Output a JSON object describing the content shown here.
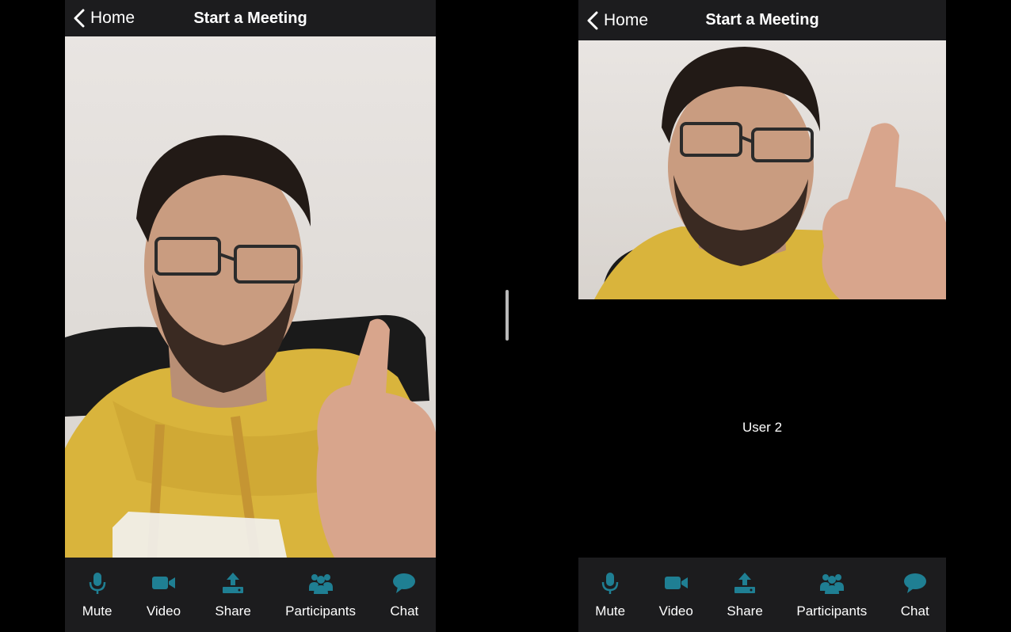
{
  "left_screen": {
    "nav": {
      "back_label": "Home",
      "title": "Start a Meeting"
    },
    "toolbar": [
      {
        "label": "Mute",
        "icon": "microphone-icon"
      },
      {
        "label": "Video",
        "icon": "video-camera-icon"
      },
      {
        "label": "Share",
        "icon": "share-upload-icon"
      },
      {
        "label": "Participants",
        "icon": "participants-icon"
      },
      {
        "label": "Chat",
        "icon": "chat-bubble-icon"
      }
    ]
  },
  "right_screen": {
    "nav": {
      "back_label": "Home",
      "title": "Start a Meeting"
    },
    "remote_user_label": "User 2",
    "toolbar": [
      {
        "label": "Mute",
        "icon": "microphone-icon"
      },
      {
        "label": "Video",
        "icon": "video-camera-icon"
      },
      {
        "label": "Share",
        "icon": "share-upload-icon"
      },
      {
        "label": "Participants",
        "icon": "participants-icon"
      },
      {
        "label": "Chat",
        "icon": "chat-bubble-icon"
      }
    ]
  },
  "colors": {
    "icon_accent": "#1f7f93",
    "bar_background": "#1c1c1e",
    "page_background": "#000000"
  }
}
